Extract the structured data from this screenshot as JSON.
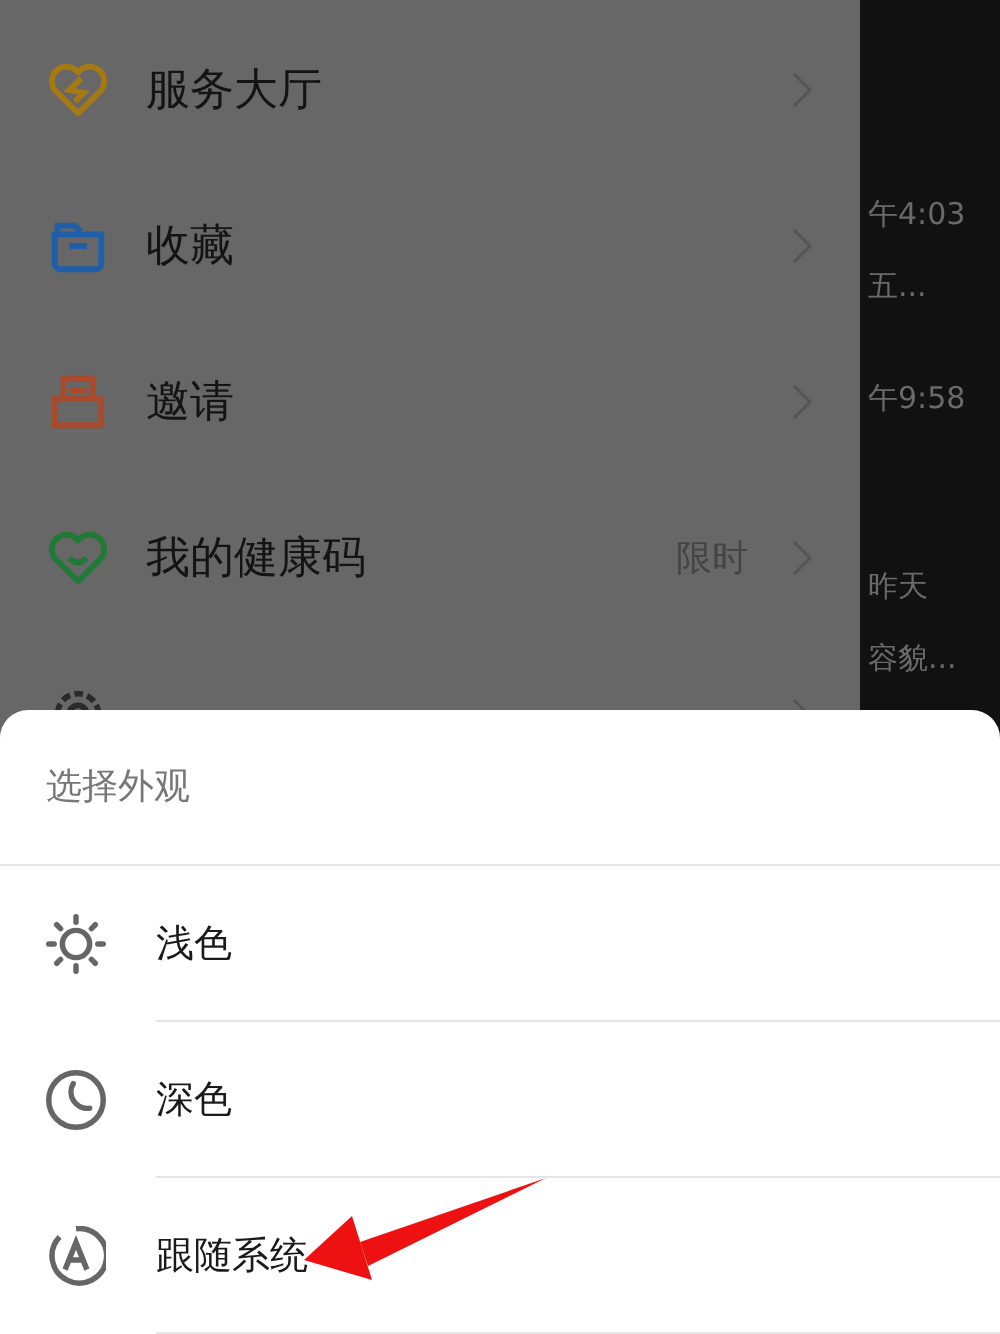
{
  "menu": {
    "items": [
      {
        "label": "服务大厅",
        "kind": "heart-link",
        "color": "#a67a12"
      },
      {
        "label": "收藏",
        "kind": "folder",
        "color": "#1f5ea8"
      },
      {
        "label": "邀请",
        "kind": "tray",
        "color": "#a84a2c"
      },
      {
        "label": "我的健康码",
        "kind": "heart-smile",
        "color": "#1e7a36",
        "badge": "限时"
      },
      {
        "kind": "gear"
      }
    ]
  },
  "chat_list_edge": [
    "午4:03",
    "五...",
    "午9:58",
    "昨天",
    "容貌..."
  ],
  "appearance_sheet": {
    "title": "选择外观",
    "options": [
      {
        "label": "浅色",
        "kind": "sun"
      },
      {
        "label": "深色",
        "kind": "moon"
      },
      {
        "label": "跟随系统",
        "kind": "auto"
      }
    ]
  },
  "annotation": {
    "kind": "arrow"
  }
}
